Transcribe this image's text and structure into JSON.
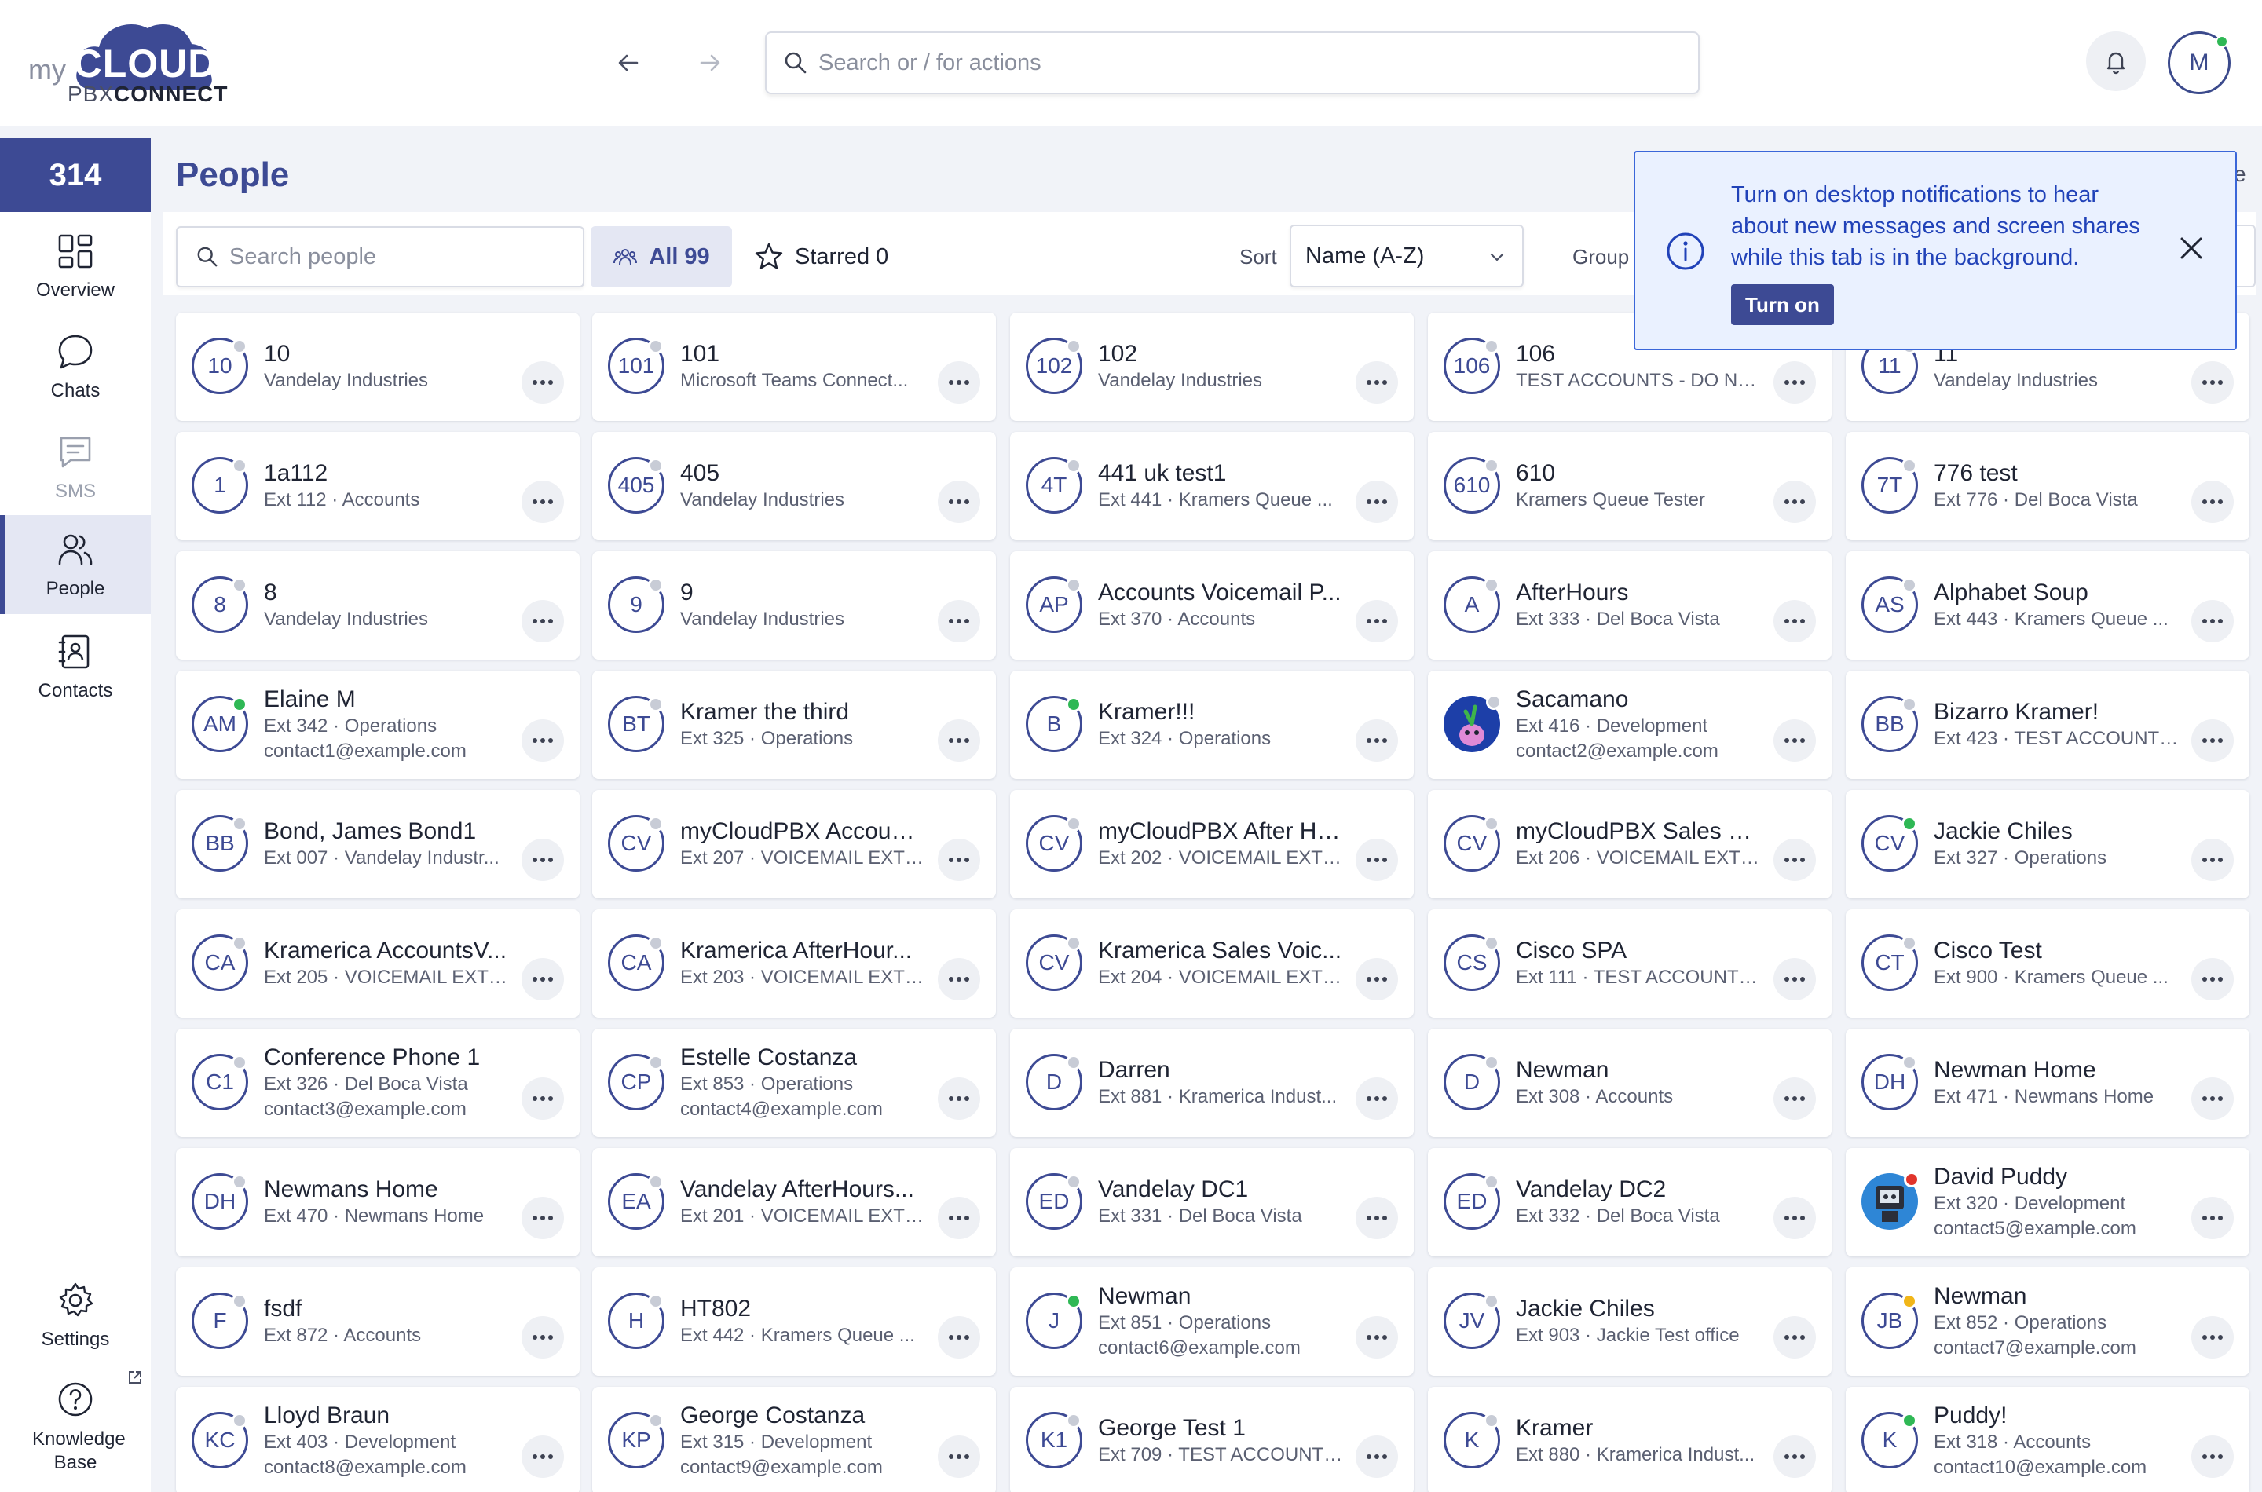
{
  "brand": {
    "my": "my",
    "cloud": "CLOUD",
    "pbx": "PBX",
    "connect": "CONNECT"
  },
  "search": {
    "placeholder": "Search or / for actions"
  },
  "user": {
    "initial": "M"
  },
  "sidebar": {
    "badge": "314",
    "items": [
      {
        "label": "Overview"
      },
      {
        "label": "Chats"
      },
      {
        "label": "SMS"
      },
      {
        "label": "People"
      },
      {
        "label": "Contacts"
      },
      {
        "label": "Settings"
      },
      {
        "label": "Knowledge Base"
      }
    ]
  },
  "page": {
    "title": "People",
    "search_placeholder": "Search people",
    "all_label": "All 99",
    "starred_label": "Starred 0",
    "sort_label": "Sort",
    "sort_value": "Name (A-Z)",
    "group_label": "Group",
    "edge_text": "e"
  },
  "notification": {
    "message": "Turn on desktop notifications to hear about new messages and screen shares while this tab is in the background.",
    "button": "Turn on"
  },
  "people": [
    {
      "initials": "10",
      "name": "10",
      "sub": "Vandelay Industries",
      "email": "",
      "status": "gray"
    },
    {
      "initials": "101",
      "name": "101",
      "sub": "Microsoft Teams Connect...",
      "email": "",
      "status": "gray"
    },
    {
      "initials": "102",
      "name": "102",
      "sub": "Vandelay Industries",
      "email": "",
      "status": "gray"
    },
    {
      "initials": "106",
      "name": "106",
      "sub": "TEST ACCOUNTS - DO NO...",
      "email": "",
      "status": "gray"
    },
    {
      "initials": "11",
      "name": "11",
      "sub": "Vandelay Industries",
      "email": "",
      "status": "gray"
    },
    {
      "initials": "1",
      "name": "1a112",
      "sub": "Ext 112 · Accounts",
      "email": "",
      "status": "gray"
    },
    {
      "initials": "405",
      "name": "405",
      "sub": "Vandelay Industries",
      "email": "",
      "status": "gray"
    },
    {
      "initials": "4T",
      "name": "441 uk test1",
      "sub": "Ext 441 · Kramers Queue ...",
      "email": "",
      "status": "gray"
    },
    {
      "initials": "610",
      "name": "610",
      "sub": "Kramers Queue Tester",
      "email": "",
      "status": "gray"
    },
    {
      "initials": "7T",
      "name": "776 test",
      "sub": "Ext 776 · Del Boca Vista",
      "email": "",
      "status": "gray"
    },
    {
      "initials": "8",
      "name": "8",
      "sub": "Vandelay Industries",
      "email": "",
      "status": "gray"
    },
    {
      "initials": "9",
      "name": "9",
      "sub": "Vandelay Industries",
      "email": "",
      "status": "gray"
    },
    {
      "initials": "AP",
      "name": "Accounts Voicemail P...",
      "sub": "Ext 370 · Accounts",
      "email": "",
      "status": "gray"
    },
    {
      "initials": "A",
      "name": "AfterHours",
      "sub": "Ext 333 · Del Boca Vista",
      "email": "",
      "status": "gray"
    },
    {
      "initials": "AS",
      "name": "Alphabet Soup",
      "sub": "Ext 443 · Kramers Queue ...",
      "email": "",
      "status": "gray"
    },
    {
      "initials": "AM",
      "name": "Elaine M",
      "sub": "Ext 342 · Operations",
      "email": "contact1@example.com",
      "status": "green"
    },
    {
      "initials": "BT",
      "name": "Kramer the third",
      "sub": "Ext 325 · Operations",
      "email": "",
      "status": "gray"
    },
    {
      "initials": "B",
      "name": "Kramer!!!",
      "sub": "Ext 324 · Operations",
      "email": "",
      "status": "green"
    },
    {
      "initials": "",
      "name": "Sacamano",
      "sub": "Ext 416 · Development",
      "email": "contact2@example.com",
      "status": "gray",
      "image": "purple"
    },
    {
      "initials": "BB",
      "name": "Bizarro Kramer!",
      "sub": "Ext 423 · TEST ACCOUNTS ...",
      "email": "",
      "status": "gray"
    },
    {
      "initials": "BB",
      "name": "Bond, James Bond1",
      "sub": "Ext 007 · Vandelay Industr...",
      "email": "",
      "status": "gray"
    },
    {
      "initials": "CV",
      "name": "myCloudPBX Account...",
      "sub": "Ext 207 · VOICEMAIL EXTE...",
      "email": "",
      "status": "gray"
    },
    {
      "initials": "CV",
      "name": "myCloudPBX After Ho...",
      "sub": "Ext 202 · VOICEMAIL EXTE...",
      "email": "",
      "status": "gray"
    },
    {
      "initials": "CV",
      "name": "myCloudPBX Sales Vo...",
      "sub": "Ext 206 · VOICEMAIL EXTE...",
      "email": "",
      "status": "gray"
    },
    {
      "initials": "CV",
      "name": "Jackie Chiles",
      "sub": "Ext 327 · Operations",
      "email": "",
      "status": "green"
    },
    {
      "initials": "CA",
      "name": "Kramerica AccountsV...",
      "sub": "Ext 205 · VOICEMAIL EXTE...",
      "email": "",
      "status": "gray"
    },
    {
      "initials": "CA",
      "name": "Kramerica AfterHour...",
      "sub": "Ext 203 · VOICEMAIL EXTE...",
      "email": "",
      "status": "gray"
    },
    {
      "initials": "CV",
      "name": "Kramerica Sales Voic...",
      "sub": "Ext 204 · VOICEMAIL EXTE...",
      "email": "",
      "status": "gray"
    },
    {
      "initials": "CS",
      "name": "Cisco SPA",
      "sub": "Ext 111 · TEST ACCOUNTS ...",
      "email": "",
      "status": "gray"
    },
    {
      "initials": "CT",
      "name": "Cisco Test",
      "sub": "Ext 900 · Kramers Queue ...",
      "email": "",
      "status": "gray"
    },
    {
      "initials": "C1",
      "name": "Conference Phone 1",
      "sub": "Ext 326 · Del Boca Vista",
      "email": "contact3@example.com",
      "status": "gray"
    },
    {
      "initials": "CP",
      "name": "Estelle Costanza",
      "sub": "Ext 853 · Operations",
      "email": "contact4@example.com",
      "status": "gray"
    },
    {
      "initials": "D",
      "name": "Darren",
      "sub": "Ext 881 · Kramerica Indust...",
      "email": "",
      "status": "gray"
    },
    {
      "initials": "D",
      "name": "Newman",
      "sub": "Ext 308 · Accounts",
      "email": "",
      "status": "gray"
    },
    {
      "initials": "DH",
      "name": "Newman Home",
      "sub": "Ext 471 · Newmans Home",
      "email": "",
      "status": "gray"
    },
    {
      "initials": "DH",
      "name": "Newmans Home",
      "sub": "Ext 470 · Newmans Home",
      "email": "",
      "status": "gray"
    },
    {
      "initials": "EA",
      "name": "Vandelay AfterHours...",
      "sub": "Ext 201 · VOICEMAIL EXTE...",
      "email": "",
      "status": "gray"
    },
    {
      "initials": "ED",
      "name": "Vandelay DC1",
      "sub": "Ext 331 · Del Boca Vista",
      "email": "",
      "status": "gray"
    },
    {
      "initials": "ED",
      "name": "Vandelay DC2",
      "sub": "Ext 332 · Del Boca Vista",
      "email": "",
      "status": "gray"
    },
    {
      "initials": "",
      "name": "David Puddy",
      "sub": "Ext 320 · Development",
      "email": "contact5@example.com",
      "status": "red",
      "image": "robot"
    },
    {
      "initials": "F",
      "name": "fsdf",
      "sub": "Ext 872 · Accounts",
      "email": "",
      "status": "gray"
    },
    {
      "initials": "H",
      "name": "HT802",
      "sub": "Ext 442 · Kramers Queue ...",
      "email": "",
      "status": "gray"
    },
    {
      "initials": "J",
      "name": "Newman",
      "sub": "Ext 851 · Operations",
      "email": "contact6@example.com",
      "status": "green"
    },
    {
      "initials": "JV",
      "name": "Jackie Chiles",
      "sub": "Ext 903 · Jackie Test office",
      "email": "",
      "status": "gray"
    },
    {
      "initials": "JB",
      "name": "Newman",
      "sub": "Ext 852 · Operations",
      "email": "contact7@example.com",
      "status": "yellow"
    },
    {
      "initials": "KC",
      "name": "Lloyd Braun",
      "sub": "Ext 403 · Development",
      "email": "contact8@example.com",
      "status": "gray"
    },
    {
      "initials": "KP",
      "name": "George Costanza",
      "sub": "Ext 315 · Development",
      "email": "contact9@example.com",
      "status": "gray"
    },
    {
      "initials": "K1",
      "name": "George Test 1",
      "sub": "Ext 709 · TEST ACCOUNTS ...",
      "email": "",
      "status": "gray"
    },
    {
      "initials": "K",
      "name": "Kramer",
      "sub": "Ext 880 · Kramerica Indust...",
      "email": "",
      "status": "gray"
    },
    {
      "initials": "K",
      "name": "Puddy!",
      "sub": "Ext 318 · Accounts",
      "email": "contact10@example.com",
      "status": "green"
    }
  ]
}
